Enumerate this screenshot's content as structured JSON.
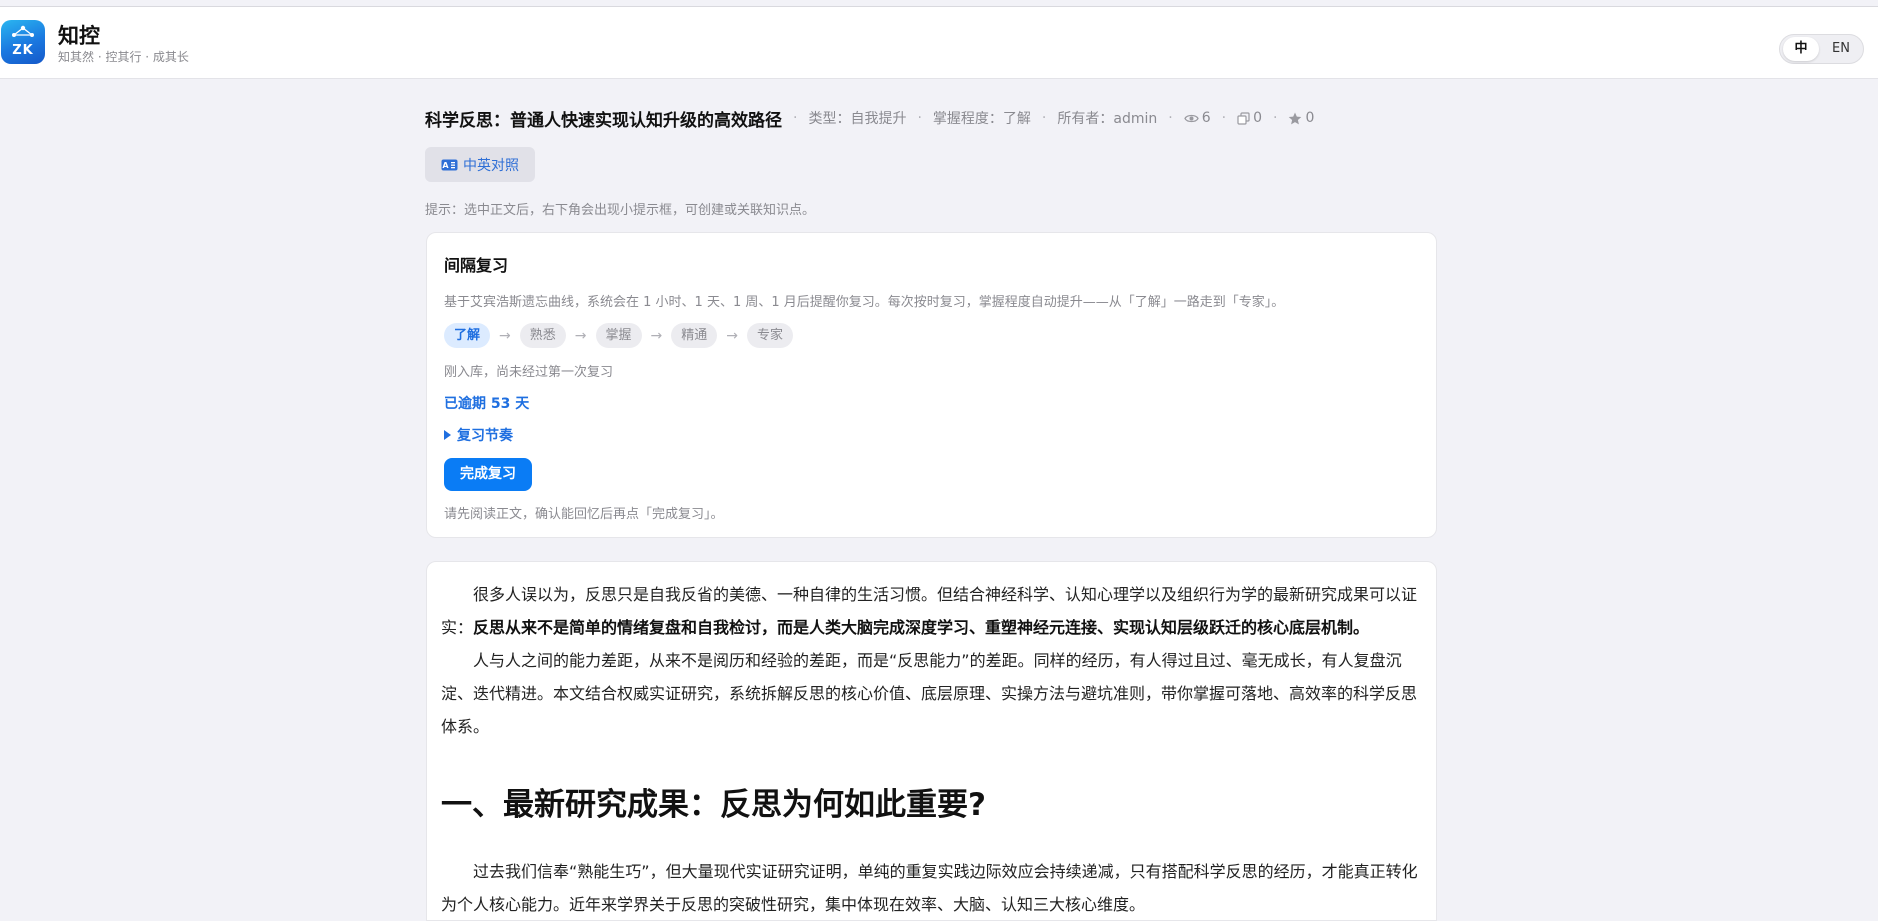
{
  "app": {
    "logo_text": "ZK",
    "title": "知控",
    "subtitle": "知其然 · 控其行 · 成其长"
  },
  "language": {
    "zh": "中",
    "en": "EN",
    "selected": "中"
  },
  "doc": {
    "title": "科学反思：普通人快速实现认知升级的高效路径",
    "type": "类型：自我提升",
    "mastery": "掌握程度：了解",
    "owner": "所有者：admin",
    "views": "6",
    "copies": "0",
    "stars": "0",
    "bilingual_label": "中英对照",
    "hint": "提示：选中正文后，右下角会出现小提示框，可创建或关联知识点。"
  },
  "review": {
    "title": "间隔复习",
    "description": "基于艾宾浩斯遗忘曲线，系统会在 1 小时、1 天、1 周、1 月后提醒你复习。每次按时复习，掌握程度自动提升——从「了解」一路走到「专家」。",
    "levels": [
      "了解",
      "熟悉",
      "掌握",
      "精通",
      "专家"
    ],
    "arrow": "→",
    "current_level": "了解",
    "status": "刚入库，尚未经过第一次复习",
    "overdue": "已逾期 53 天",
    "rhythm_label": "复习节奏",
    "complete_button": "完成复习",
    "note": "请先阅读正文，确认能回忆后再点「完成复习」。"
  },
  "article": {
    "p1_plain": "很多人误以为，反思只是自我反省的美德、一种自律的生活习惯。但结合神经科学、认知心理学以及组织行为学的最新研究成果可以证实：",
    "p1_bold": "反思从来不是简单的情绪复盘和自我检讨，而是人类大脑完成深度学习、重塑神经元连接、实现认知层级跃迁的核心底层机制。",
    "p2": "人与人之间的能力差距，从来不是阅历和经验的差距，而是“反思能力”的差距。同样的经历，有人得过且过、毫无成长，有人复盘沉淀、迭代精进。本文结合权威实证研究，系统拆解反思的核心价值、底层原理、实操方法与避坑准则，带你掌握可落地、高效率的科学反思体系。",
    "h2": "一、最新研究成果：反思为何如此重要?",
    "p3": "过去我们信奉“熟能生巧”，但大量现代实证研究证明，单纯的重复实践边际效应会持续递减，只有搭配科学反思的经历，才能真正转化为个人核心能力。近年来学界关于反思的突破性研究，集中体现在效率、大脑、认知三大核心维度。"
  },
  "colors": {
    "accent": "#0a7cf5",
    "link": "#1f6fe0",
    "page_bg": "#f2f2f7",
    "card_bg": "#ffffff",
    "muted_text": "#8a8a90"
  }
}
